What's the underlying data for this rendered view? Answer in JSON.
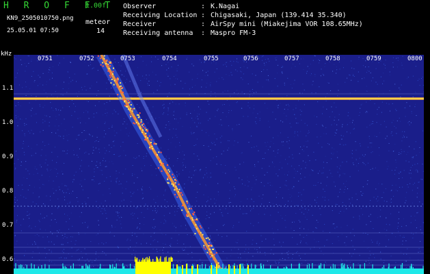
{
  "header": {
    "logo": "H R O F F T",
    "version": "1.00f",
    "filename": "KN9_2505010750.png",
    "mode": "meteor",
    "datetime": "25.05.01 07:50",
    "count": "14"
  },
  "info": [
    {
      "key": "Observer",
      "value": "K.Nagai"
    },
    {
      "key": "Receiving Location",
      "value": "Chigasaki, Japan (139.414 35.340)"
    },
    {
      "key": "Receiver",
      "value": "AirSpy mini (Miakejima VOR 108.65MHz)"
    },
    {
      "key": "Receiving antenna",
      "value": "Maspro FM-3"
    }
  ],
  "axis": {
    "y_unit": "kHz",
    "y_ticks": [
      "1.1",
      "1.0",
      "0.9",
      "0.8",
      "0.7",
      "0.6"
    ],
    "x_ticks": [
      "0751",
      "0752",
      "0753",
      "0754",
      "0755",
      "0756",
      "0757",
      "0758",
      "0759",
      "0800"
    ]
  },
  "colors": {
    "background": "#1a1e8a",
    "carrier": "#ffd34a",
    "trail": "#ff9a2a",
    "baseline": "#1ee8e8",
    "burst": "#ffff00"
  }
}
